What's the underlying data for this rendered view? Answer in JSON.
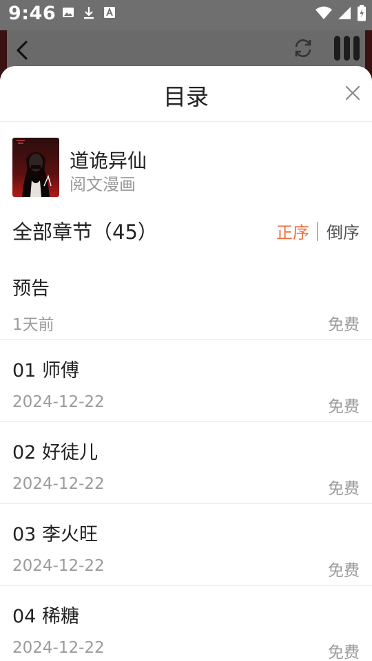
{
  "status_bar": {
    "time": "9:46",
    "icons": [
      "image-icon",
      "download-icon",
      "text-a-icon",
      "wifi-icon",
      "signal-icon",
      "battery-icon"
    ]
  },
  "app_bar": {
    "icons": [
      "back-arrow-icon",
      "refresh-icon",
      "panel-icon"
    ]
  },
  "sheet": {
    "title": "目录",
    "close_icon": "close-icon"
  },
  "book": {
    "title": "道诡异仙",
    "source": "阅文漫画"
  },
  "chapters": {
    "heading": "全部章节（45）",
    "sort_asc": "正序",
    "sort_desc": "倒序",
    "active_sort_color": "#f26b3a",
    "items": [
      {
        "title": "预告",
        "date": "1天前",
        "price": "免费"
      },
      {
        "title": "01 师傅",
        "date": "2024-12-22",
        "price": "免费"
      },
      {
        "title": "02 好徒儿",
        "date": "2024-12-22",
        "price": "免费"
      },
      {
        "title": "03 李火旺",
        "date": "2024-12-22",
        "price": "免费"
      },
      {
        "title": "04 稀糖",
        "date": "2024-12-22",
        "price": "免费"
      }
    ]
  }
}
